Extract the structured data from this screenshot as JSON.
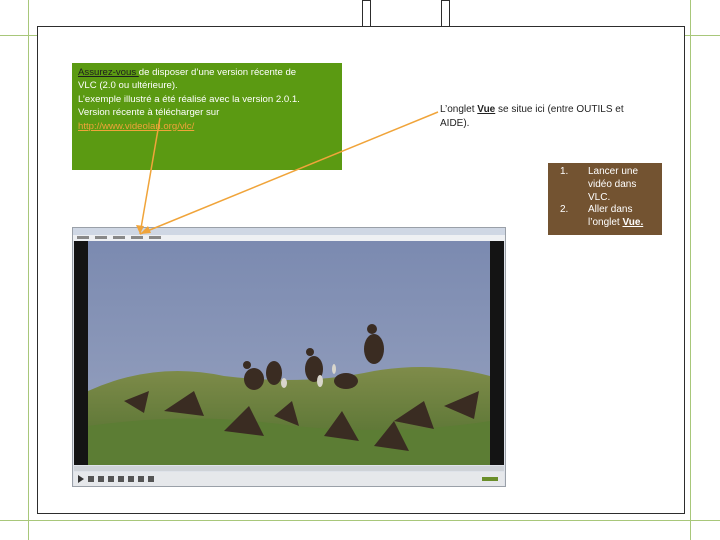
{
  "green_box": {
    "lines": [
      {
        "underlined": "Assurez-vous ",
        "rest": "de disposer d’une version récente de"
      },
      {
        "text": "VLC (2.0 ou ultérieure)."
      },
      {
        "text": "L’exemple illustré a été réalisé avec la version 2.0.1."
      },
      {
        "text": "Version récente à télécharger sur"
      }
    ],
    "link": "http://www.videolan.org/vlc/"
  },
  "right_note": {
    "prefix": "L’onglet ",
    "underlined": "Vue",
    "suffix": " se situe ici (entre OUTILS et AIDE)."
  },
  "steps": [
    {
      "num": "1.",
      "text": "Lancer une vidéo dans VLC."
    },
    {
      "num": "2.",
      "text_prefix": "Aller dans l’onglet ",
      "underlined": "Vue."
    }
  ],
  "colors": {
    "green_box_bg": "#5b9a12",
    "brown_box_bg": "#735331",
    "arrow": "#f0a43a"
  }
}
